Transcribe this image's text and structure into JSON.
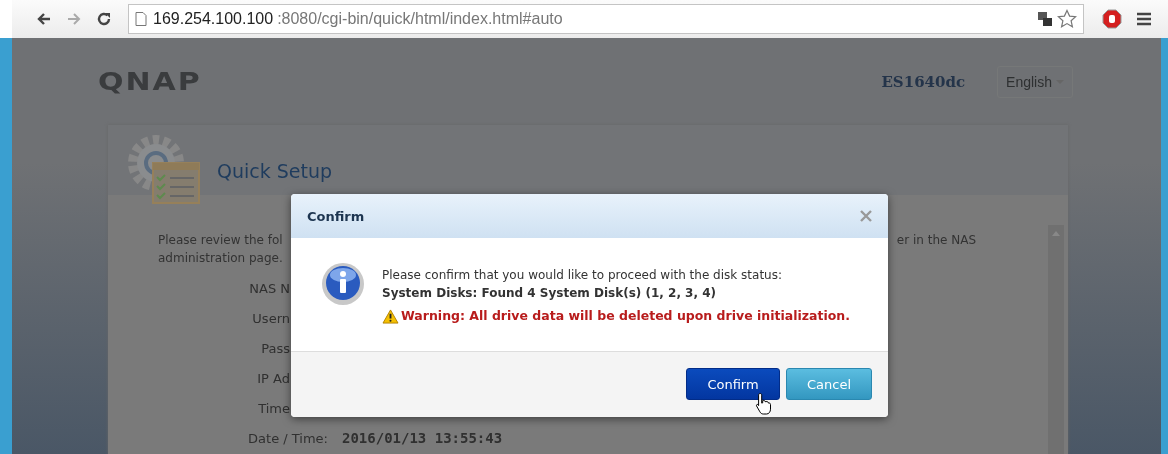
{
  "browser": {
    "url_host": "169.254.100.100",
    "url_path": ":8080/cgi-bin/quick/html/index.html#auto"
  },
  "header": {
    "logo": "QNAP",
    "model": "ES1640dc",
    "language": "English"
  },
  "panel": {
    "title": "Quick Setup",
    "intro_line_1": "Please review the fol",
    "intro_line_2": "administration page.",
    "intro_tail": "er in the NAS",
    "fields": [
      {
        "label": "NAS N"
      },
      {
        "label": "Usern"
      },
      {
        "label": "Pass"
      },
      {
        "label": "IP Ad"
      },
      {
        "label": "Time"
      },
      {
        "label": "Date / Time:",
        "value": "2016/01/13 13:55:43"
      }
    ]
  },
  "dialog": {
    "title": "Confirm",
    "message": "Please confirm that you would like to proceed with the disk status:",
    "status": "System Disks: Found 4 System Disk(s) (1, 2, 3, 4)",
    "warning": "Warning: All drive data will be deleted upon drive initialization.",
    "buttons": [
      {
        "label": "Confirm",
        "kind": "primary"
      },
      {
        "label": "Cancel",
        "kind": "secondary"
      }
    ]
  }
}
